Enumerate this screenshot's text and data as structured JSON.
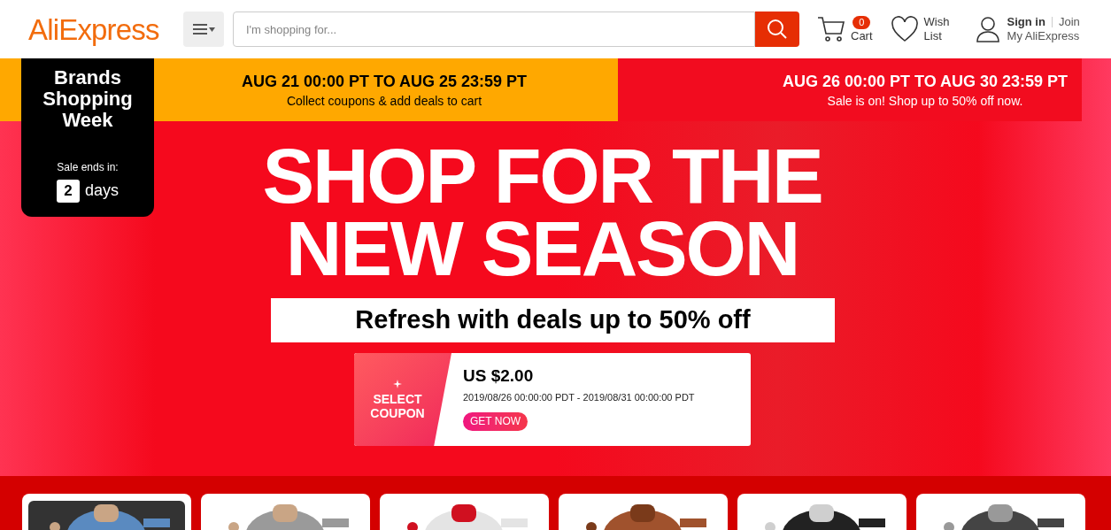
{
  "header": {
    "logo": "AliExpress",
    "search": {
      "placeholder": "I'm shopping for..."
    },
    "cart": {
      "count": "0",
      "label": "Cart"
    },
    "wishlist": {
      "label": "Wish List"
    },
    "account": {
      "sign_in": "Sign in",
      "join": "Join",
      "my_account": "My AliExpress"
    }
  },
  "phases": [
    {
      "dates": "AUG 21 00:00 PT TO AUG 25 23:59 PT",
      "note": "Collect coupons & add deals to cart",
      "color": "#ffa800"
    },
    {
      "dates": "AUG 26 00:00 PT TO AUG 30 23:59 PT",
      "note": "Sale is on! Shop up to 50% off now.",
      "color": "#f20c1f"
    }
  ],
  "countdown": {
    "title": "Brands Shopping Week",
    "label": "Sale ends in:",
    "count": "2",
    "unit": "days"
  },
  "hero": {
    "headline": [
      "SHOP FOR THE",
      "NEW SEASON"
    ],
    "subtitle": "Refresh with deals up to 50% off"
  },
  "coupon": {
    "side_label": "SELECT COUPON",
    "amount": "US $2.00",
    "validity": "2019/08/26 00:00:00 PDT - 2019/08/31 00:00:00 PDT",
    "button": "GET NOW"
  }
}
